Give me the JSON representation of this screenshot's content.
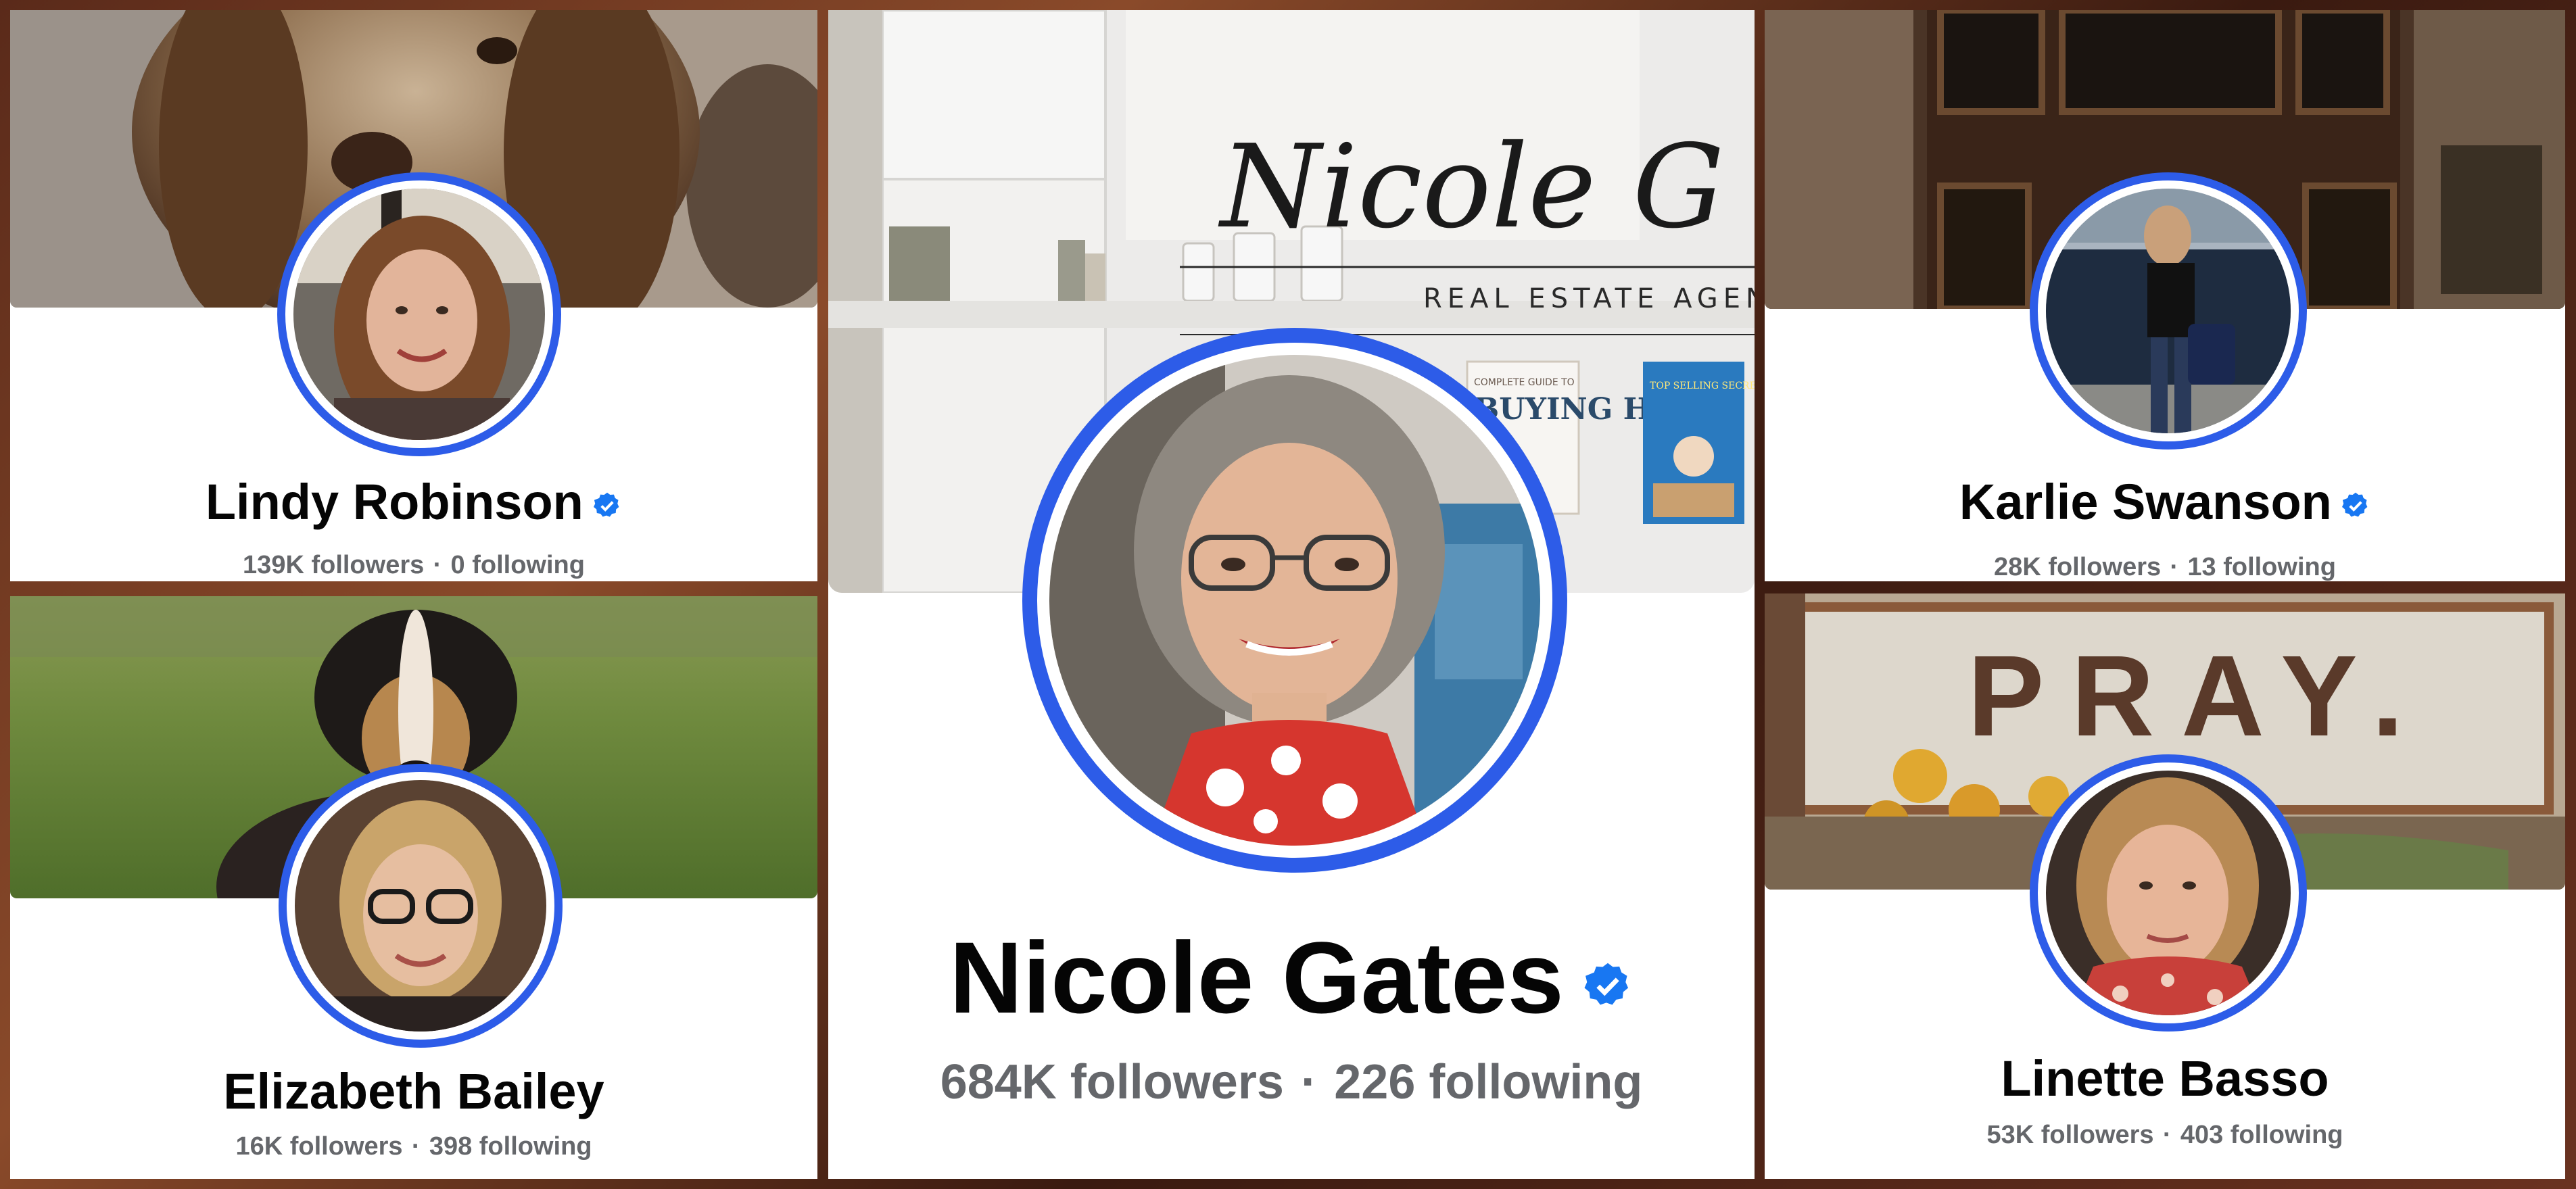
{
  "profiles": {
    "lindy": {
      "name": "Lindy Robinson",
      "followers": "139K followers",
      "following": "0 following",
      "verified": true,
      "cover": "dog-cover-icon"
    },
    "elizabeth": {
      "name": "Elizabeth Bailey",
      "followers": "16K followers",
      "following": "398 following",
      "verified": false,
      "cover": "collie-in-field-icon"
    },
    "nicole": {
      "name": "Nicole Gates",
      "followers": "684K followers",
      "following": "226 following",
      "verified": true,
      "cover_script": "Nicole G",
      "cover_subtitle": "REAL ESTATE AGEN",
      "book1": "BUYING HOME",
      "book1_top": "COMPLETE GUIDE TO",
      "book2": "TOP SELLING SECRETS FOR HOMEOWNERS"
    },
    "karlie": {
      "name": "Karlie Swanson",
      "followers": "28K followers",
      "following": "13 following",
      "verified": true,
      "cover": "rustic-doorway-icon"
    },
    "linette": {
      "name": "Linette Basso",
      "followers": "53K followers",
      "following": "403 following",
      "verified": false,
      "cover_sign": "PRAY."
    }
  },
  "separator": "·",
  "colors": {
    "verified": "#1877f2",
    "ring": "#2d5ce8",
    "name": "#050505",
    "stats": "#65676b"
  }
}
